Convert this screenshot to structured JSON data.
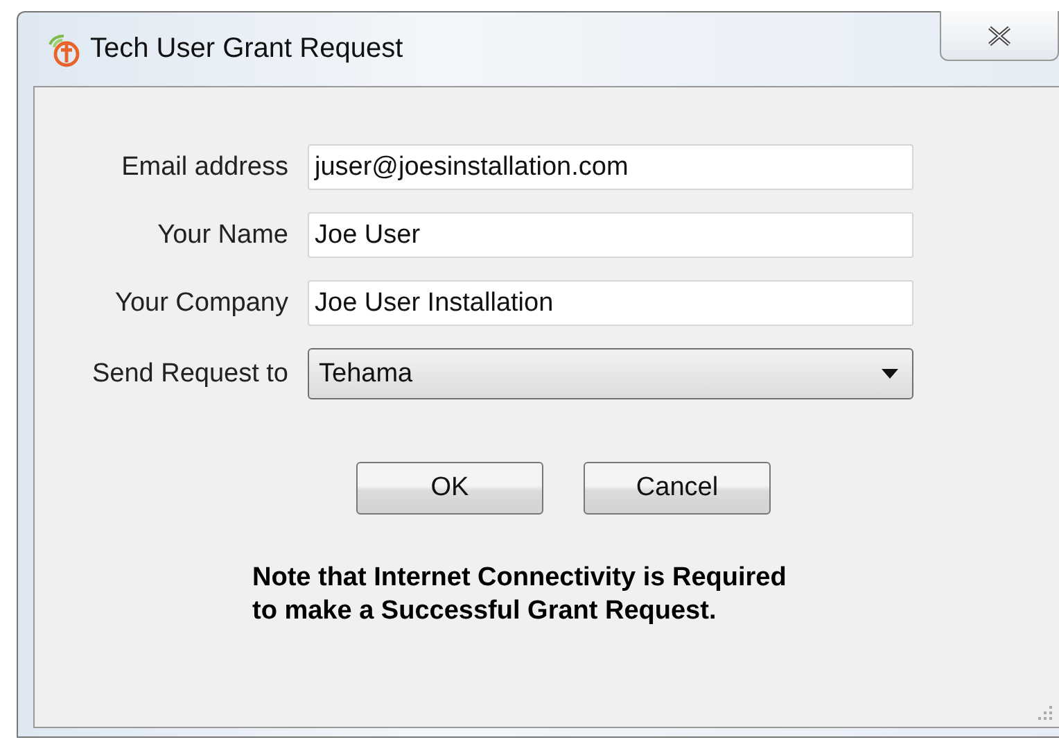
{
  "window": {
    "title": "Tech User Grant Request"
  },
  "fields": [
    {
      "label": "Email address",
      "value": "juser@joesinstallation.com",
      "kind": "text"
    },
    {
      "label": "Your Name",
      "value": "Joe User",
      "kind": "text"
    },
    {
      "label": "Your Company",
      "value": "Joe User Installation",
      "kind": "text"
    },
    {
      "label": "Send Request to",
      "value": "Tehama",
      "kind": "dropdown"
    }
  ],
  "buttons": [
    "OK",
    "Cancel"
  ],
  "note": [
    "Note that Internet Connectivity is Required",
    "to make a Successful Grant Request."
  ]
}
